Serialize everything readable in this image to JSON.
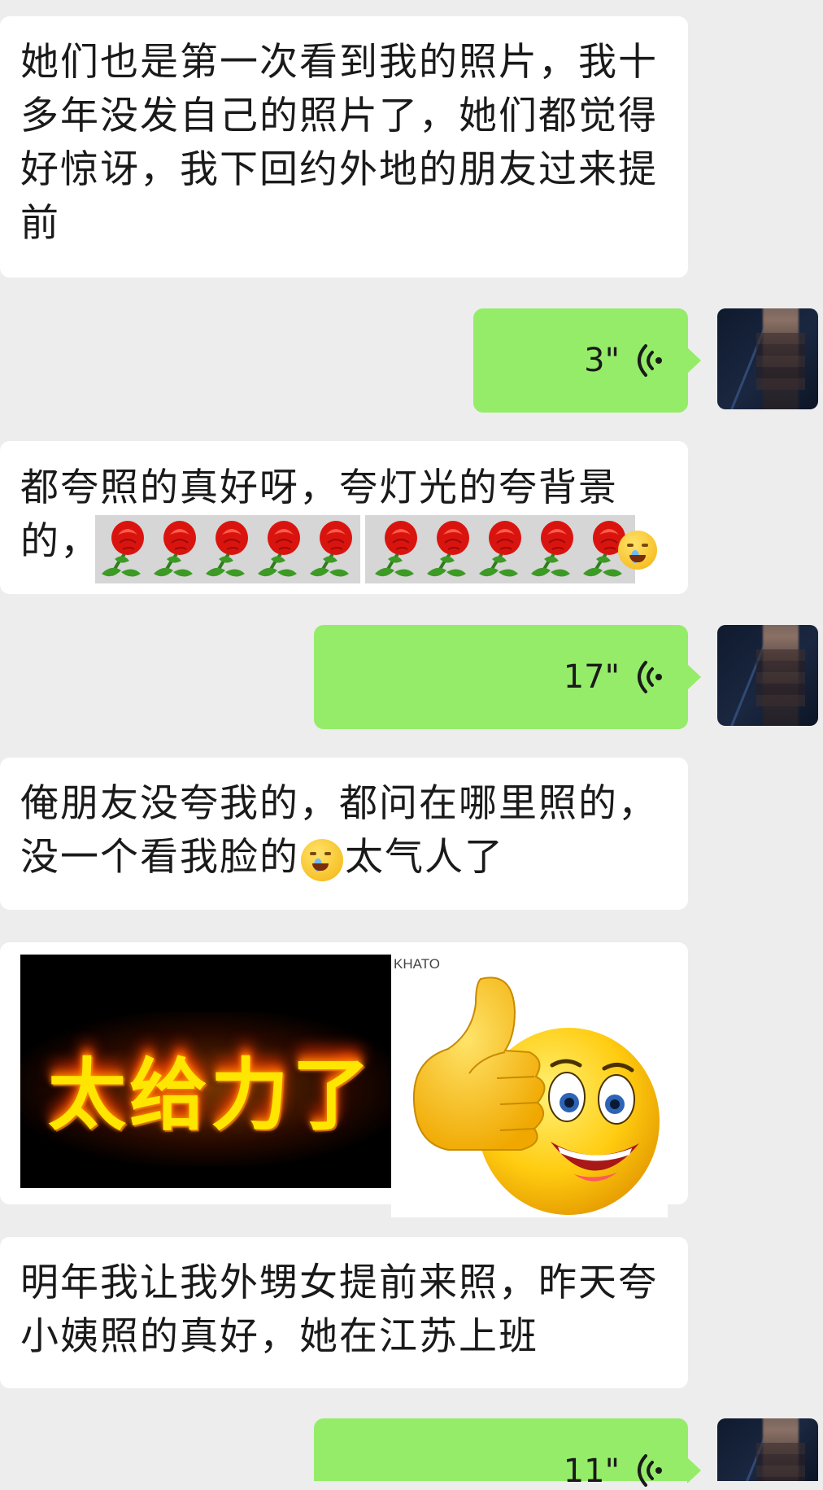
{
  "messages": [
    {
      "type": "text-in",
      "text": "她们也是第一次看到我的照片，我十多年没发自己的照片了，她们都觉得好惊讶，我下回约外地的朋友过来提前"
    },
    {
      "type": "voice-out",
      "duration": "3\""
    },
    {
      "type": "text-in",
      "text": "都夸照的真好呀，夸灯光的夸背景的，",
      "emojis": [
        "rose",
        "rose",
        "rose",
        "rose",
        "rose",
        "rose",
        "rose",
        "rose",
        "rose",
        "rose",
        "crying-face"
      ]
    },
    {
      "type": "voice-out",
      "duration": "17\""
    },
    {
      "type": "text-in",
      "text_before": "俺朋友没夸我的，都问在哪里照的，没一个看我脸的",
      "emoji": "loudly-crying-face",
      "text_after": "太气人了"
    },
    {
      "type": "stickers-in",
      "fire_text": "太给力了",
      "watermark": "KHATO",
      "second_sticker": "thumbs-up-smiley"
    },
    {
      "type": "text-in",
      "text": "明年我让我外甥女提前来照，昨天夸小姨照的真好，她在江苏上班"
    },
    {
      "type": "voice-out",
      "duration": "11\""
    }
  ],
  "colors": {
    "background": "#ededed",
    "incoming_bubble": "#ffffff",
    "outgoing_bubble": "#95ec69"
  },
  "icons": {
    "voice": "voice-wave-icon",
    "avatar": "user-avatar"
  }
}
